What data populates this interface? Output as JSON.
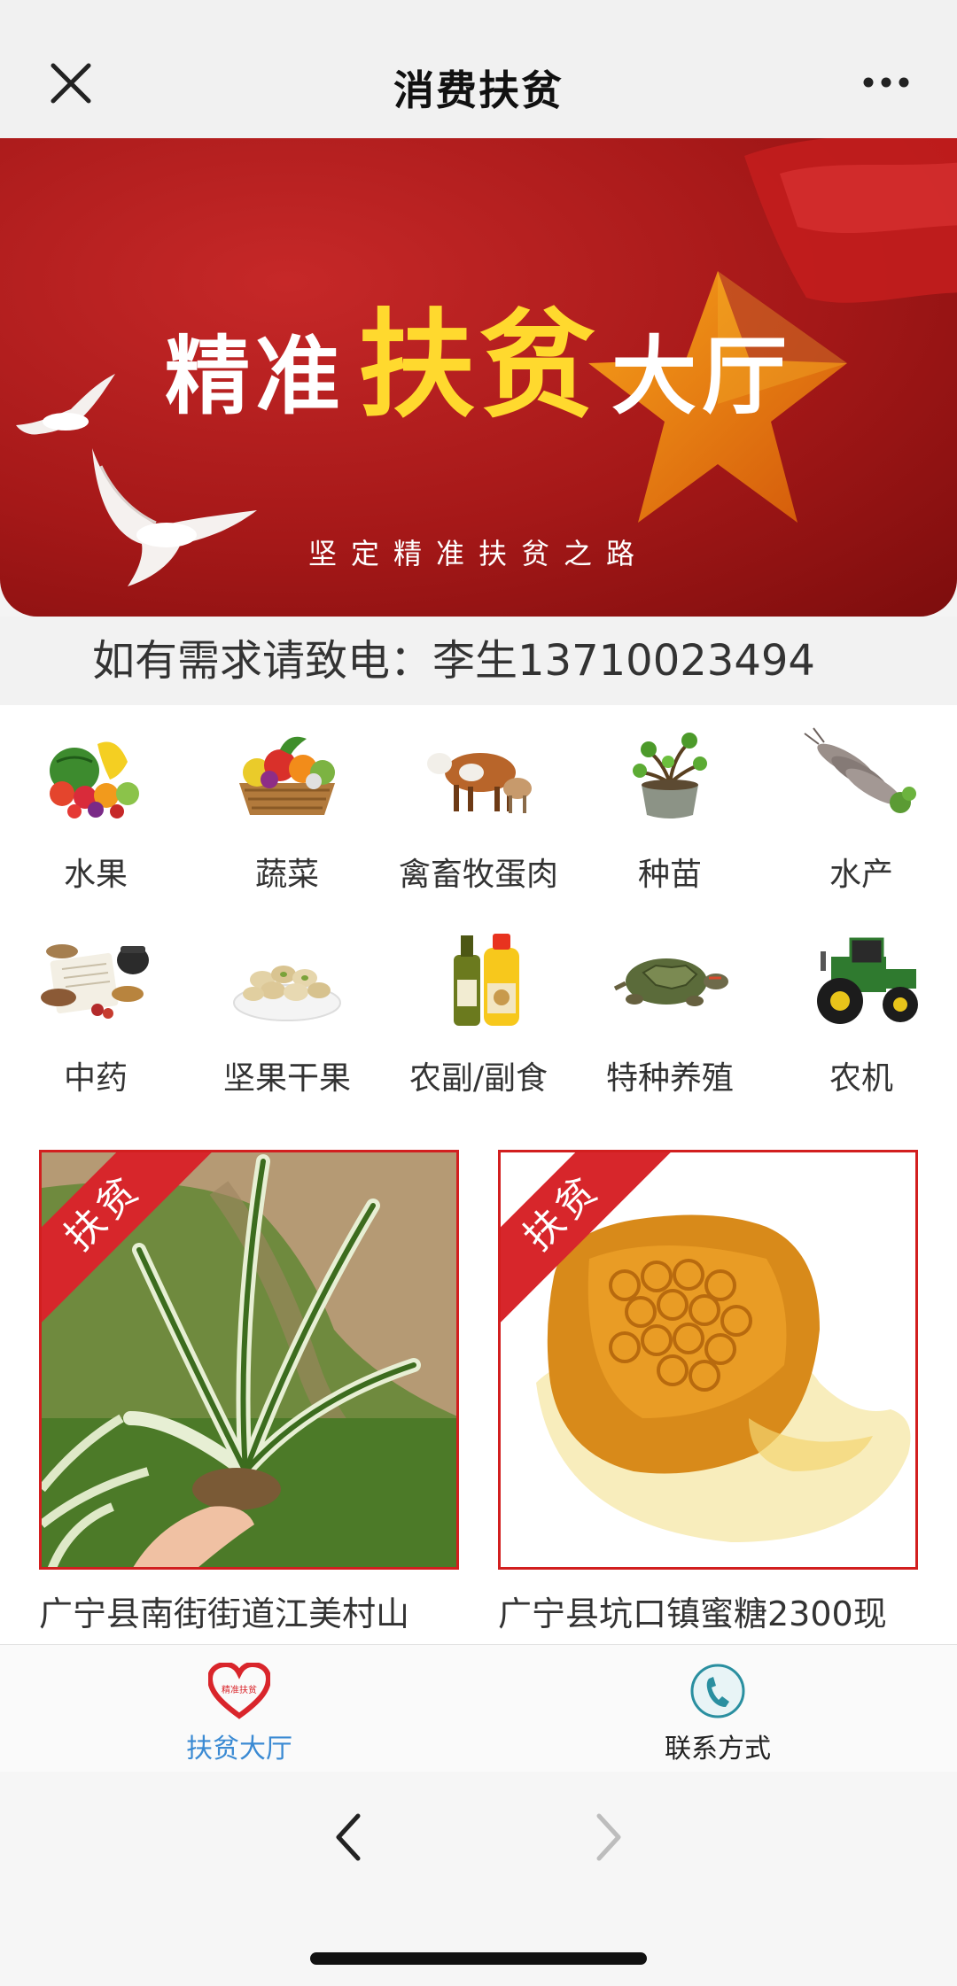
{
  "navbar": {
    "title": "消费扶贫",
    "close_icon": "close-icon",
    "more_icon": "more-dots-icon"
  },
  "banner": {
    "title_part1": "精准",
    "title_part2": "扶贫",
    "title_part3": "大厅",
    "subtitle": "坚定精准扶贫之路",
    "colors": {
      "background": "#a51818",
      "highlight": "#ffd92e",
      "star": "#e87a10"
    }
  },
  "hotline": {
    "text": "如有需求请致电：李生13710023494"
  },
  "categories": [
    {
      "label": "水果",
      "icon": "fruit-icon"
    },
    {
      "label": "蔬菜",
      "icon": "vegetable-basket-icon"
    },
    {
      "label": "禽畜牧蛋肉",
      "icon": "cattle-icon"
    },
    {
      "label": "种苗",
      "icon": "seedling-pot-icon"
    },
    {
      "label": "水产",
      "icon": "shrimp-icon"
    },
    {
      "label": "中药",
      "icon": "herbal-medicine-icon"
    },
    {
      "label": "坚果干果",
      "icon": "nuts-bowl-icon"
    },
    {
      "label": "农副/副食",
      "icon": "oil-bottle-icon"
    },
    {
      "label": "特种养殖",
      "icon": "turtle-icon"
    },
    {
      "label": "农机",
      "icon": "tractor-icon"
    }
  ],
  "products": [
    {
      "ribbon": "扶贫",
      "name": "广宁县南街街道江美村山",
      "image": "spider-plant-photo"
    },
    {
      "ribbon": "扶贫",
      "name": "广宁县坑口镇蜜糖2300现",
      "image": "honeycomb-photo"
    }
  ],
  "tabbar": {
    "tabs": [
      {
        "label": "扶贫大厅",
        "icon": "heart-logo-icon",
        "badge_text": "精准扶贫",
        "active": true
      },
      {
        "label": "联系方式",
        "icon": "phone-icon",
        "active": false
      }
    ],
    "active_color": "#3a8ad3"
  },
  "browser": {
    "back_icon": "chevron-left-icon",
    "forward_icon": "chevron-right-icon"
  }
}
